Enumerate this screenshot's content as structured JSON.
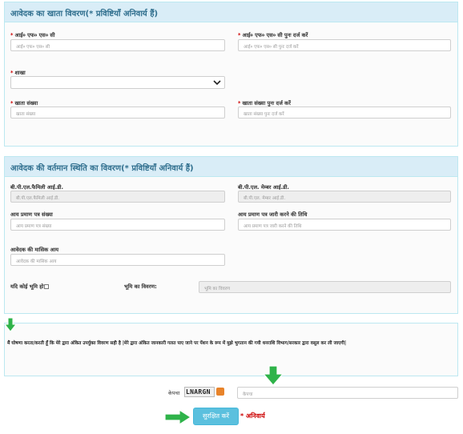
{
  "colors": {
    "panel_header_bg": "#d9edf7",
    "panel_header_text": "#31708f",
    "required": "#cc0000",
    "button": "#5bc0de",
    "arrow": "#2fb34a"
  },
  "account_panel": {
    "title": "आवेदक का खाता विवरण(* प्रविष्टियाँ अनिवार्य हैं)",
    "ifsc": {
      "label": "आई० एफ० एस० सी",
      "placeholder": "आई० एफ० एस० सी"
    },
    "ifsc_confirm": {
      "label": "आई० एफ० एस० सी पुनः दर्ज करें",
      "placeholder": "आई० एफ० एस० सी पुनः दर्ज करें"
    },
    "branch": {
      "label": "शाखा",
      "value": ""
    },
    "account_no": {
      "label": "खाता संख्या",
      "placeholder": "खाता संख्या"
    },
    "account_no_confirm": {
      "label": "खाता संख्या पुनः दर्ज करें",
      "placeholder": "खाता संख्या पुनः दर्ज करें"
    }
  },
  "status_panel": {
    "title": "आवेदक की वर्तमान स्थिति का विवरण(* प्रविष्टियाँ अनिवार्य हैं)",
    "bpl_family_id": {
      "label": "बी.पी.एल.फैमिली आई.डी.",
      "placeholder": "बी.पी.एल.फैमिली आई.डी."
    },
    "bpl_member_id": {
      "label": "बी.पी.एल. मेम्बर आई.डी.",
      "placeholder": "बी.पी.एल. मेम्बर आई.डी."
    },
    "income_cert_no": {
      "label": "आय प्रमाण पत्र संख्या",
      "placeholder": "आय प्रमाण पत्र संख्या"
    },
    "income_cert_date": {
      "label": "आय प्रमाण पत्र जारी करने की तिथि",
      "placeholder": "आय प्रमाण पत्र जारी करने की तिथि"
    },
    "monthly_income": {
      "label": "आवेदक की मासिक आय",
      "placeholder": "आवेदक की मासिक आय"
    },
    "land_check_label": "यदि कोई भूमि हो",
    "land_details": {
      "label": "भूमि का विवरण:",
      "placeholder": "भूमि का विवरण"
    }
  },
  "declaration": {
    "text": "मैं घोषणा करता/करती हूँ कि मेरे द्वारा अंकित उपर्युक्त विवरण सही है |मेरे द्वारा अंकित जानकारी गलत पाए जाने पर पेंशन के रूप में मुझे भुगतान की गयी धनराशि विभाग/सरकार द्वारा वसूल कर ली जाएगी|"
  },
  "captcha": {
    "label": "केपचा",
    "code": "LNARGN",
    "placeholder": "केपचा"
  },
  "submit": {
    "label": "सुरक्षित करें",
    "mandatory_note": "* अनिवार्य"
  }
}
